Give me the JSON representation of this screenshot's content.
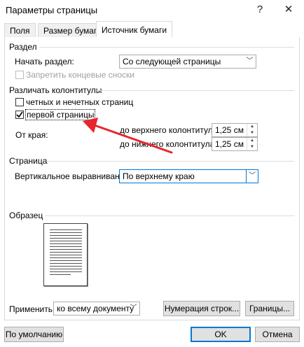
{
  "window": {
    "title": "Параметры страницы",
    "help_glyph": "?",
    "close_glyph": "✕"
  },
  "tabs": [
    {
      "label": "Поля",
      "active": false
    },
    {
      "label": "Размер бумаги",
      "active": false
    },
    {
      "label": "Источник бумаги",
      "active": true
    }
  ],
  "section": {
    "heading": "Раздел",
    "start_label": "Начать раздел:",
    "start_value": "Со следующей страницы",
    "suppress_endnotes_label": "Запретить концевые сноски",
    "suppress_endnotes_checked": false,
    "suppress_endnotes_disabled": true
  },
  "headers_footers": {
    "heading": "Различать колонтитулы",
    "odd_even_label": "четных и нечетных страниц",
    "odd_even_checked": false,
    "first_page_label": "первой страницы",
    "first_page_checked": true,
    "from_edge_label": "От края:",
    "header_label": "до верхнего колонтитула:",
    "header_value": "1,25 см",
    "footer_label": "до нижнего колонтитула:",
    "footer_value": "1,25 см"
  },
  "page": {
    "heading": "Страница",
    "valign_label": "Вертикальное выравнивание:",
    "valign_value": "По верхнему краю"
  },
  "preview": {
    "heading": "Образец"
  },
  "apply": {
    "label": "Применить:",
    "value": "ко всему документу"
  },
  "buttons": {
    "line_numbers": "Нумерация строк...",
    "borders": "Границы...",
    "default": "По умолчанию",
    "ok": "OK",
    "cancel": "Отмена"
  },
  "colors": {
    "annotation_arrow": "#e8252d",
    "accent": "#0078d7"
  }
}
